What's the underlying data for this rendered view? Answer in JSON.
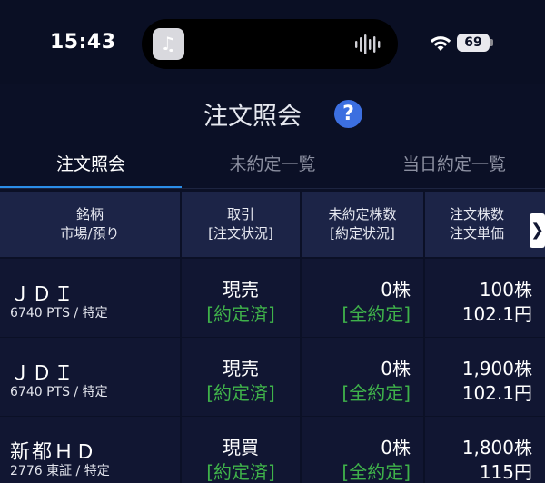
{
  "status_bar": {
    "time": "15:43",
    "battery": "69"
  },
  "header": {
    "title": "注文照会",
    "help": "?"
  },
  "tabs": [
    {
      "label": "注文照会",
      "active": true
    },
    {
      "label": "未約定一覧",
      "active": false
    },
    {
      "label": "当日約定一覧",
      "active": false
    }
  ],
  "table": {
    "headers": {
      "col1": [
        "銘柄",
        "市場/預り"
      ],
      "col2": [
        "取引",
        "[注文状況]"
      ],
      "col3": [
        "未約定株数",
        "[約定状況]"
      ],
      "col4": [
        "注文株数",
        "注文単価"
      ]
    },
    "scroll_icon": "❯",
    "rows": [
      {
        "name": "ＪＤＩ",
        "market": "6740 PTS / 特定",
        "trade": "現売",
        "order_status": "[約定済]",
        "unfilled": "0株",
        "fill_status": "[全約定]",
        "quantity": "100株",
        "price": "102.1円"
      },
      {
        "name": "ＪＤＩ",
        "market": "6740 PTS / 特定",
        "trade": "現売",
        "order_status": "[約定済]",
        "unfilled": "0株",
        "fill_status": "[全約定]",
        "quantity": "1,900株",
        "price": "102.1円"
      },
      {
        "name": "新都ＨＤ",
        "market": "2776 東証 / 特定",
        "trade": "現買",
        "order_status": "[約定済]",
        "unfilled": "0株",
        "fill_status": "[全約定]",
        "quantity": "1,800株",
        "price": "115円"
      }
    ]
  },
  "colors": {
    "accent": "#2b8de8",
    "status_green": "#3fb24a",
    "help_blue": "#3c6fe0"
  }
}
